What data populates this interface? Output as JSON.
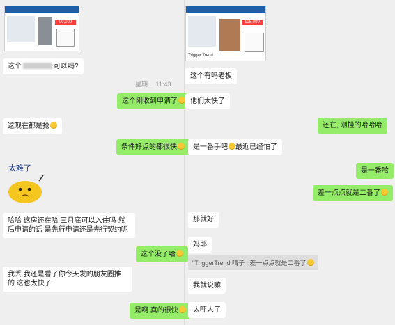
{
  "time_label": "星期一 11:43",
  "left": {
    "msg1_prefix": "这个",
    "msg1_suffix": "可以吗?",
    "msg_green1": "这个刚收到申请了",
    "msg_now": "这现在都是抢",
    "msg_green2": "条件好点的都很快",
    "sticker_text": "太难了",
    "msg_long": "哈哈 这房还在哈 三月底可以入住吗 然后申请的话 是先行申请还是先行契约呢",
    "msg_green3": "这个没了哈",
    "msg_friend": "我丢 我还是看了你今天发的朋友圈推的 这也太快了",
    "msg_green4": "是啊 真的很快"
  },
  "right": {
    "msg_ask": "这个有吗老板",
    "msg_fast": "他们太快了",
    "msg_green_still": "还在, 刚挂的哈哈哈",
    "msg_first": "是一番手吧",
    "msg_first_tail": "最近已经怕了",
    "msg_green_yes": "是一番哈",
    "msg_green_second": "差一点点就是二番了",
    "msg_ok": "那就好",
    "msg_mom": "妈耶",
    "msg_quote": "\"TriggerTrend 晴子 : 差一点点就是二番了",
    "msg_knew": "我就说嘛",
    "msg_scary": "太吓人了"
  },
  "listing_left": {
    "price": "90,000"
  },
  "listing_right": {
    "price": "125,000",
    "brand": "Trigger Trend"
  },
  "colors": {
    "green": "#95ec69",
    "white": "#ffffff",
    "background": "#efefef"
  }
}
